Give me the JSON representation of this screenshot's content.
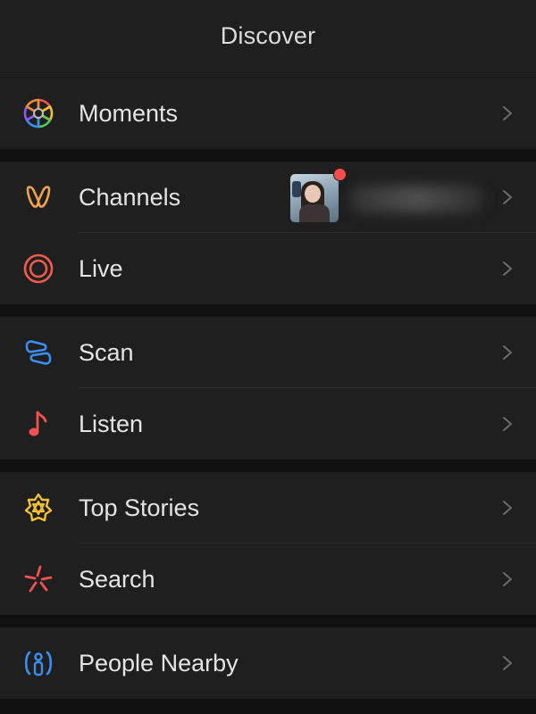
{
  "header": {
    "title": "Discover"
  },
  "groups": [
    {
      "items": [
        {
          "label": "Moments",
          "icon": "moments-aperture-icon"
        }
      ]
    },
    {
      "items": [
        {
          "label": "Channels",
          "icon": "channels-icon"
        },
        {
          "label": "Live",
          "icon": "live-icon"
        }
      ]
    },
    {
      "items": [
        {
          "label": "Scan",
          "icon": "scan-icon"
        },
        {
          "label": "Listen",
          "icon": "music-note-icon"
        }
      ]
    },
    {
      "items": [
        {
          "label": "Top Stories",
          "icon": "top-stories-icon"
        },
        {
          "label": "Search",
          "icon": "search-sparkle-icon"
        }
      ]
    },
    {
      "items": [
        {
          "label": "People Nearby",
          "icon": "people-nearby-icon"
        }
      ]
    }
  ],
  "colors": {
    "background": "#111111",
    "surface": "#1f1f1f",
    "channels": "#f0a24a",
    "live": "#ef5b4d",
    "scan": "#3a8ef2",
    "listen": "#f05252",
    "top_stories": "#f1c232",
    "search": "#f05252",
    "people_nearby": "#3a8ef2",
    "notification_dot": "#f24c4c"
  }
}
